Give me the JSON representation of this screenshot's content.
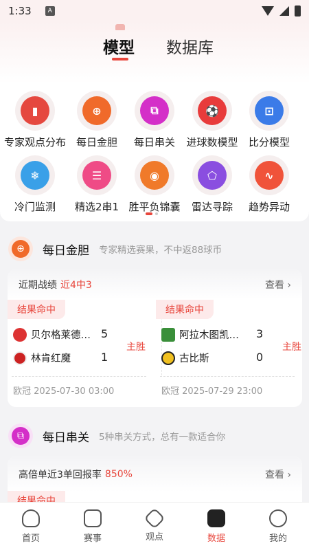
{
  "status": {
    "time": "1:33",
    "sim_label": "A"
  },
  "tabs": {
    "model": "模型",
    "database": "数据库"
  },
  "features": [
    {
      "label": "专家观点分布",
      "icon": "bar-chart-icon",
      "color": "#e5483f"
    },
    {
      "label": "每日金胆",
      "icon": "target-icon",
      "color": "#f06a2a"
    },
    {
      "label": "每日串关",
      "icon": "link-icon",
      "color": "#d42fc8"
    },
    {
      "label": "进球数模型",
      "icon": "soccer-ball-icon",
      "color": "#e83b3b"
    },
    {
      "label": "比分模型",
      "icon": "scoreboard-icon",
      "color": "#3b7be8"
    },
    {
      "label": "冷门监测",
      "icon": "snowflake-icon",
      "color": "#3aa0e8"
    },
    {
      "label": "精选2串1",
      "icon": "checklist-icon",
      "color": "#ef4b86"
    },
    {
      "label": "胜平负锦囊",
      "icon": "pouch-icon",
      "color": "#f07a2a"
    },
    {
      "label": "雷达寻踪",
      "icon": "radar-icon",
      "color": "#8a4ee0"
    },
    {
      "label": "趋势异动",
      "icon": "pulse-icon",
      "color": "#f0533a"
    }
  ],
  "daily_banker": {
    "title": "每日金胆",
    "subtitle": "专家精选赛果，不中返88球币",
    "record_label": "近期战绩",
    "record_value": "近4中3",
    "more": "查看",
    "matches": [
      {
        "badge": "结果命中",
        "home": "贝尔格莱德…",
        "away": "林肯红魔",
        "home_score": "5",
        "away_score": "1",
        "result": "主胜",
        "info": "欧冠  2025-07-30 03:00"
      },
      {
        "badge": "结果命中",
        "home": "阿拉木图凯…",
        "away": "古比斯",
        "home_score": "3",
        "away_score": "0",
        "result": "主胜",
        "info": "欧冠  2025-07-29 23:00"
      }
    ]
  },
  "daily_parlay": {
    "title": "每日串关",
    "subtitle": "5种串关方式，总有一款适合你",
    "record_label": "高倍单近3单回报率",
    "record_value": "850%",
    "more": "查看",
    "badge": "结果命中"
  },
  "nav": [
    {
      "label": "首页",
      "icon": "home-icon",
      "active": false
    },
    {
      "label": "赛事",
      "icon": "calendar-icon",
      "active": false
    },
    {
      "label": "观点",
      "icon": "opinion-icon",
      "active": false
    },
    {
      "label": "数据",
      "icon": "data-icon",
      "active": true
    },
    {
      "label": "我的",
      "icon": "profile-icon",
      "active": false
    }
  ]
}
